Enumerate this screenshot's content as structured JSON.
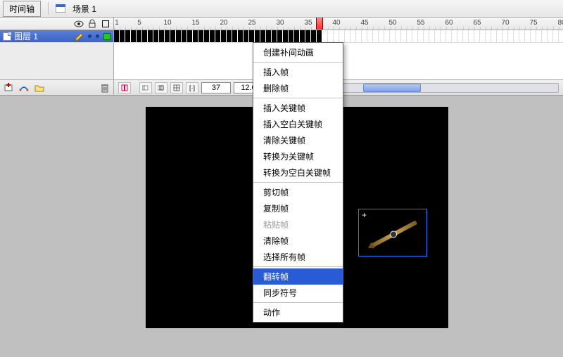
{
  "topbar": {
    "timeline_tab": "时间轴",
    "scene_label": "场景 1"
  },
  "timeline": {
    "ruler_step": 5,
    "ruler_start": 1,
    "ruler_end": 85,
    "frame_width": 8,
    "playhead_frame": 37,
    "layer": {
      "name": "图层 1",
      "keyframe_count": 37
    },
    "footer": {
      "current_frame": "37",
      "fps": "12.0"
    }
  },
  "context_menu": {
    "items": [
      {
        "label": "创建补间动画",
        "disabled": false
      },
      {
        "sep": true
      },
      {
        "label": "插入帧",
        "disabled": false
      },
      {
        "label": "删除帧",
        "disabled": false
      },
      {
        "sep": true
      },
      {
        "label": "插入关键帧",
        "disabled": false
      },
      {
        "label": "插入空白关键帧",
        "disabled": false
      },
      {
        "label": "清除关键帧",
        "disabled": false
      },
      {
        "label": "转换为关键帧",
        "disabled": false
      },
      {
        "label": "转换为空白关键帧",
        "disabled": false
      },
      {
        "sep": true
      },
      {
        "label": "剪切帧",
        "disabled": false
      },
      {
        "label": "复制帧",
        "disabled": false
      },
      {
        "label": "粘贴帧",
        "disabled": true
      },
      {
        "label": "清除帧",
        "disabled": false
      },
      {
        "label": "选择所有帧",
        "disabled": false
      },
      {
        "sep": true
      },
      {
        "label": "翻转帧",
        "disabled": false,
        "hover": true
      },
      {
        "label": "同步符号",
        "disabled": false
      },
      {
        "sep": true
      },
      {
        "label": "动作",
        "disabled": false
      }
    ]
  },
  "icons": {
    "eye": "eye-icon",
    "lock": "lock-icon",
    "outline": "outline-square-icon",
    "pencil": "pencil-icon",
    "add_layer": "add-layer-icon",
    "add_guide": "add-motion-guide-icon",
    "add_folder": "add-folder-icon",
    "delete": "trash-icon"
  }
}
